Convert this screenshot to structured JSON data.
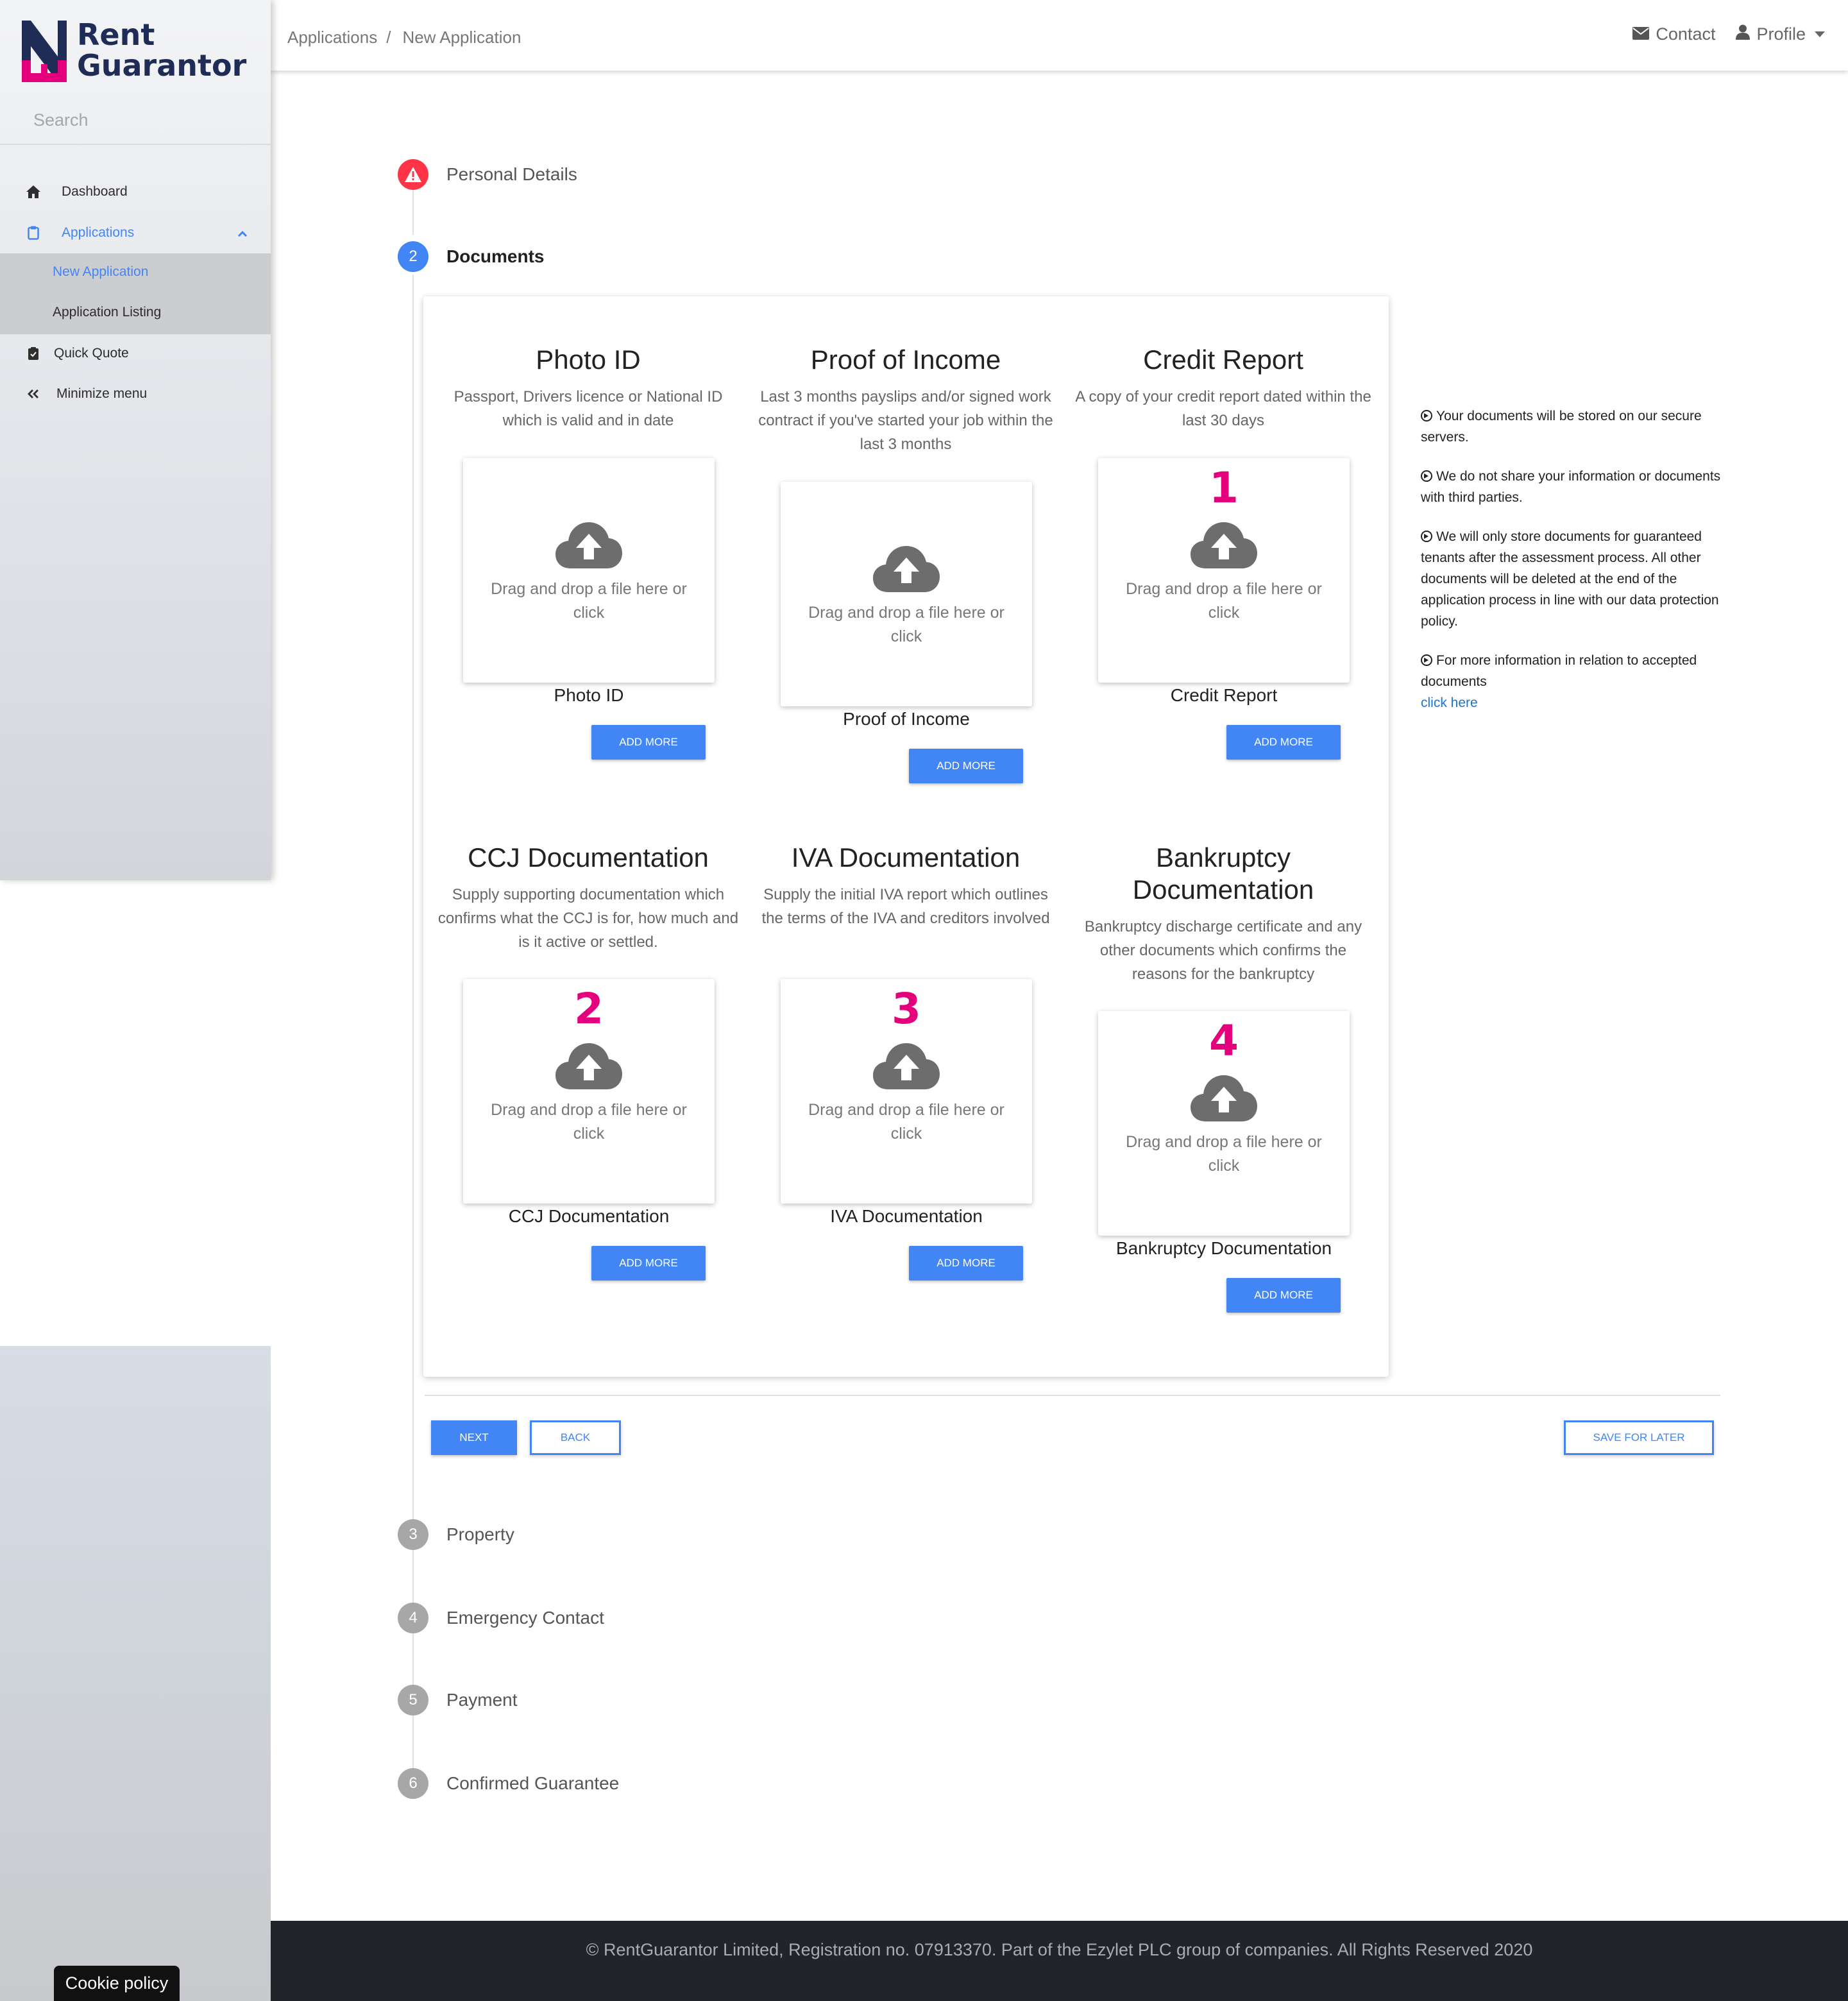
{
  "brand": {
    "line1": "Rent",
    "line2": "Guarantor",
    "colors": {
      "navy": "#1f2d56",
      "pink": "#e4007c"
    }
  },
  "sidebar": {
    "search_placeholder": "Search",
    "items": [
      {
        "label": "Dashboard",
        "icon": "home-icon"
      },
      {
        "label": "Applications",
        "icon": "clipboard-icon"
      },
      {
        "label": "Quick Quote",
        "icon": "clipboard-check-icon"
      },
      {
        "label": "Minimize menu",
        "icon": "double-chevron-left-icon"
      }
    ],
    "sub_items": [
      {
        "label": "New Application"
      },
      {
        "label": "Application Listing"
      }
    ]
  },
  "header": {
    "breadcrumb": [
      "Applications",
      "New Application"
    ],
    "breadcrumb_sep": "/",
    "contact": "Contact",
    "profile": "Profile"
  },
  "steps": [
    {
      "number": "!",
      "label": "Personal Details",
      "status": "error"
    },
    {
      "number": "2",
      "label": "Documents",
      "status": "active"
    },
    {
      "number": "3",
      "label": "Property",
      "status": "pending"
    },
    {
      "number": "4",
      "label": "Emergency Contact",
      "status": "pending"
    },
    {
      "number": "5",
      "label": "Payment",
      "status": "pending"
    },
    {
      "number": "6",
      "label": "Confirmed Guarantee",
      "status": "pending"
    }
  ],
  "documents": [
    {
      "title": "Photo ID",
      "desc": "Passport, Drivers licence or National ID which is valid and in date",
      "marker": "",
      "dropzone_text": "Drag and drop a file here or click",
      "label": "Photo ID",
      "button": "ADD MORE"
    },
    {
      "title": "Proof of Income",
      "desc": "Last 3 months payslips and/or signed work contract if you've started your job within the last 3 months",
      "marker": "",
      "dropzone_text": "Drag and drop a file here or click",
      "label": "Proof of Income",
      "button": "ADD MORE"
    },
    {
      "title": "Credit Report",
      "desc": "A copy of your credit report dated within the last 30 days",
      "marker": "1",
      "dropzone_text": "Drag and drop a file here or click",
      "label": "Credit Report",
      "button": "ADD MORE"
    },
    {
      "title": "CCJ Documentation",
      "desc": "Supply supporting documentation which confirms what the CCJ is for, how much and is it active or settled.",
      "marker": "2",
      "dropzone_text": "Drag and drop a file here or click",
      "label": "CCJ Documentation",
      "button": "ADD MORE"
    },
    {
      "title": "IVA Documentation",
      "desc": "Supply the initial IVA report which outlines the terms of the IVA and creditors involved",
      "marker": "3",
      "dropzone_text": "Drag and drop a file here or click",
      "label": "IVA Documentation",
      "button": "ADD MORE"
    },
    {
      "title": "Bankruptcy Documentation",
      "desc": "Bankruptcy discharge certificate and any other documents which confirms the reasons for the bankruptcy",
      "marker": "4",
      "dropzone_text": "Drag and drop a file here or click",
      "label": "Bankruptcy Documentation",
      "button": "ADD MORE"
    }
  ],
  "info": {
    "points": [
      "Your documents will be stored on our secure servers.",
      "We do not share your information or documents with third parties.",
      "We will only store documents for guaranteed tenants after the assessment process. All other documents will be deleted at the end of the application process in line with our data protection policy.",
      "For more information in relation to accepted documents"
    ],
    "link": "click here"
  },
  "actions": {
    "next": "NEXT",
    "back": "BACK",
    "save": "SAVE FOR LATER"
  },
  "footer": "© RentGuarantor Limited, Registration no. 07913370. Part of the Ezylet PLC group of companies. All Rights Reserved 2020",
  "cookie": "Cookie policy"
}
